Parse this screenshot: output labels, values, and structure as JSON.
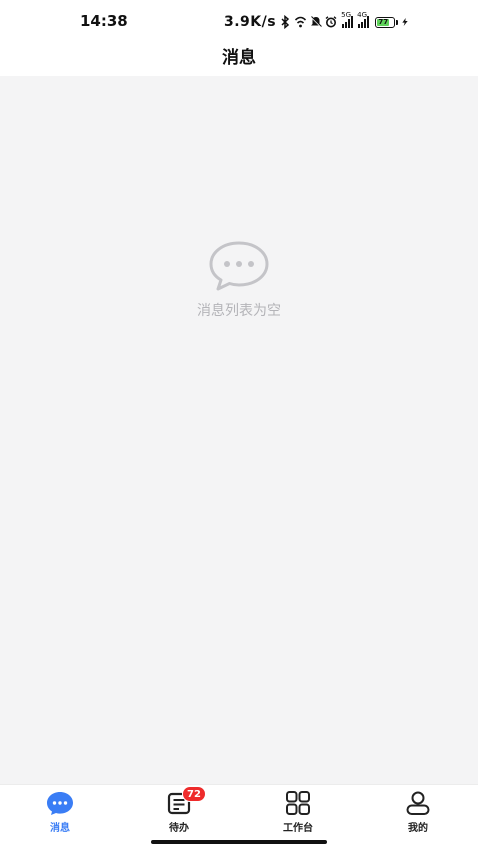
{
  "status_bar": {
    "time": "14:38",
    "network_speed": "3.9K/s",
    "signal_1_label": "5G",
    "signal_2_label": "4G",
    "battery_level": "77",
    "icons": [
      "bluetooth-icon",
      "wifi-icon",
      "mute-icon",
      "alarm-icon",
      "signal-5g-icon",
      "signal-4g-icon",
      "battery-icon",
      "charging-icon"
    ]
  },
  "header": {
    "title": "消息"
  },
  "main": {
    "empty_icon": "chat-bubble-icon",
    "empty_text": "消息列表为空"
  },
  "tab_bar": {
    "tabs": [
      {
        "label": "消息",
        "icon": "message-icon",
        "active": true
      },
      {
        "label": "待办",
        "icon": "todo-icon",
        "badge": "72"
      },
      {
        "label": "工作台",
        "icon": "workbench-grid-icon"
      },
      {
        "label": "我的",
        "icon": "profile-icon"
      }
    ]
  },
  "colors": {
    "accent": "#3a7df5",
    "badge": "#ee2b2b",
    "content_background": "#f4f4f5",
    "empty_text": "#b4b4b8",
    "battery": "#5ed35a"
  }
}
